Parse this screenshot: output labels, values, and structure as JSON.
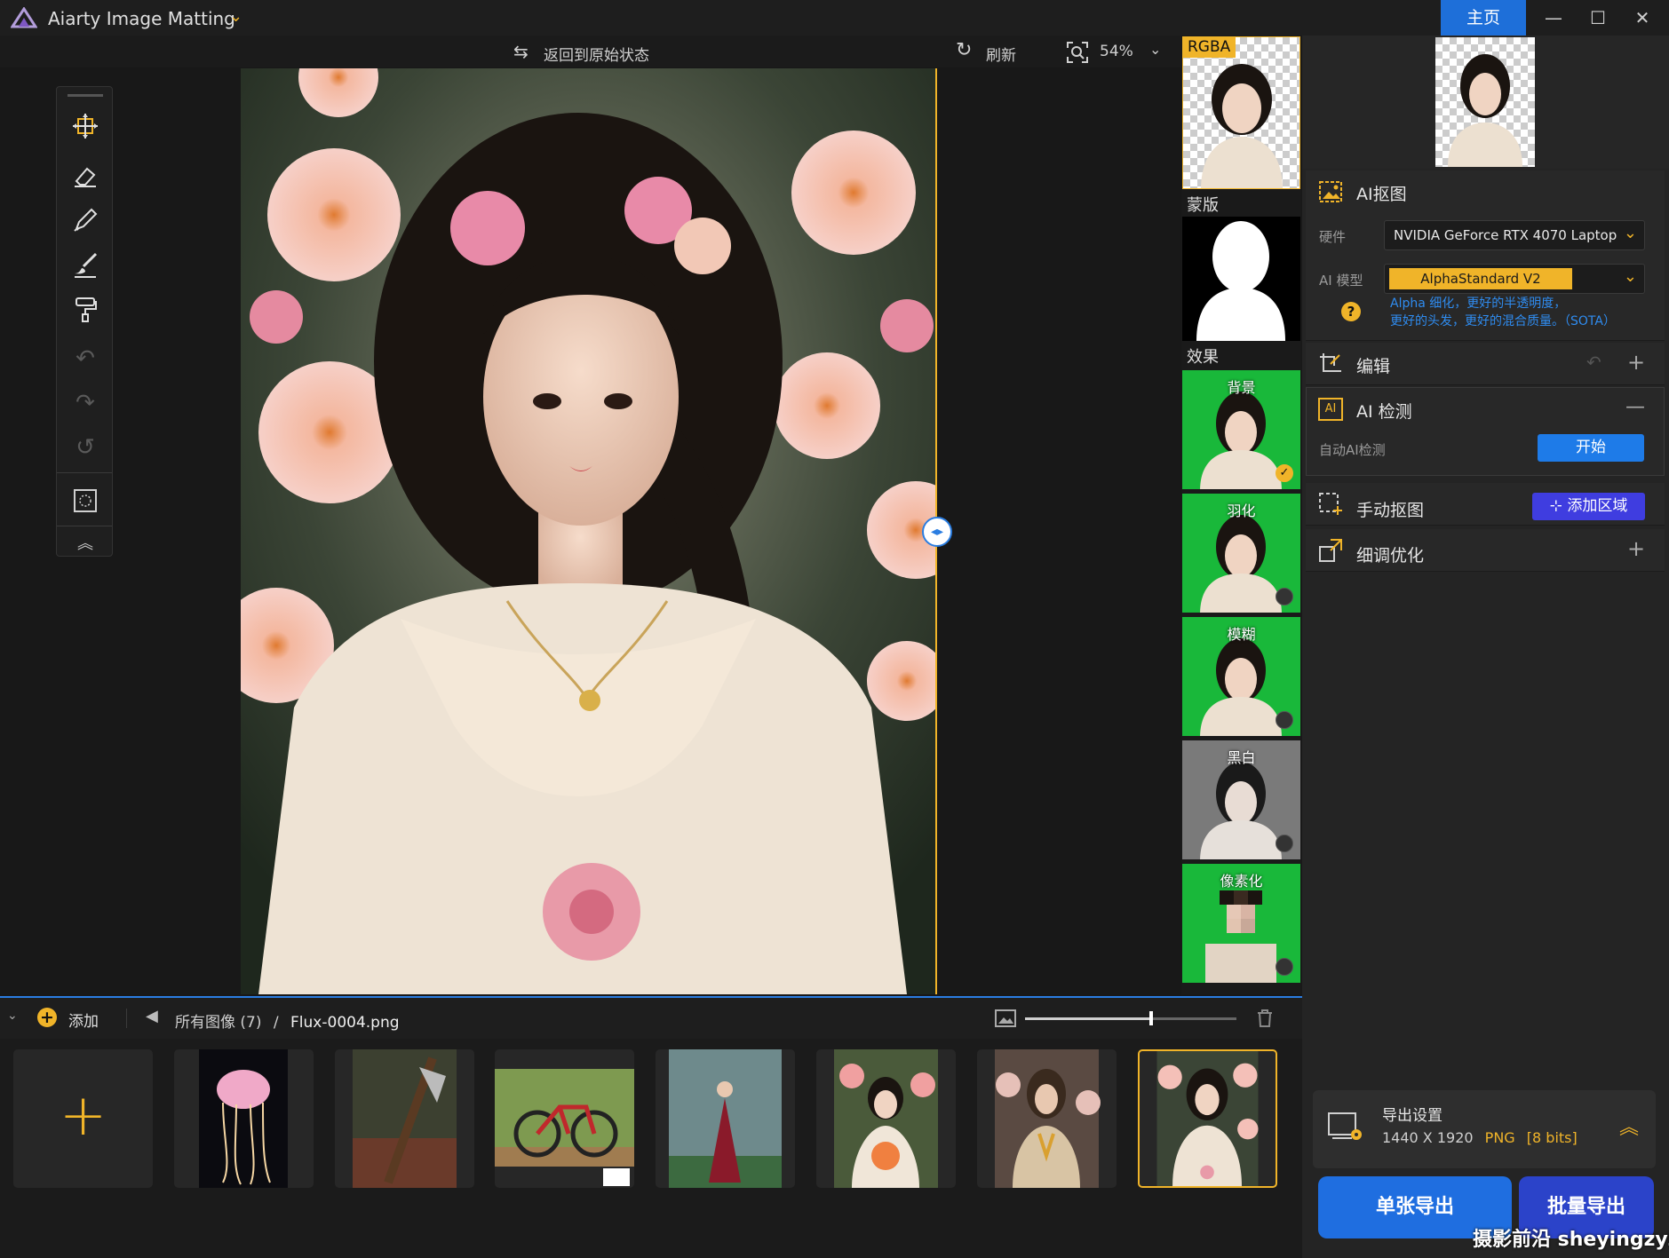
{
  "app": {
    "title": "Aiarty Image Matting",
    "home_label": "主页"
  },
  "topbar": {
    "revert_label": "返回到原始状态",
    "refresh_label": "刷新",
    "zoom_value": "54%"
  },
  "preview": {
    "rgba_label": "RGBA",
    "mask_label": "蒙版",
    "effects_label": "效果",
    "effects": [
      {
        "label": "背景",
        "selected": true
      },
      {
        "label": "羽化",
        "selected": false
      },
      {
        "label": "模糊",
        "selected": false
      },
      {
        "label": "黑白",
        "selected": false
      },
      {
        "label": "像素化",
        "selected": false
      }
    ]
  },
  "panel": {
    "ai_cutout_title": "AI抠图",
    "hardware_label": "硬件",
    "hardware_value": "NVIDIA GeForce RTX 4070 Laptop (",
    "model_label": "AI 模型",
    "model_value": "AlphaStandard  V2",
    "model_desc_1": "Alpha 细化，更好的半透明度，",
    "model_desc_2": "更好的头发，更好的混合质量。（SOTA）",
    "help_icon": "?",
    "edit_title": "编辑",
    "ai_detect_title": "AI 检测",
    "auto_detect_label": "自动AI检测",
    "start_label": "开始",
    "manual_title": "手动抠图",
    "add_region_label": "添加区域",
    "refine_title": "细调优化"
  },
  "export": {
    "title": "导出设置",
    "size": "1440 X 1920",
    "format": "PNG",
    "bits": "[8 bits]",
    "single_label": "单张导出",
    "batch_label": "批量导出"
  },
  "browser": {
    "add_label": "添加",
    "all_images": "所有图像 (7)",
    "separator": "/",
    "current_file": "Flux-0004.png"
  },
  "watermark": "摄影前沿 sheyingzyz.com",
  "colors": {
    "accent_blue": "#1e6fd9",
    "accent_yellow": "#f0b429",
    "green_bg": "#19b83a"
  }
}
